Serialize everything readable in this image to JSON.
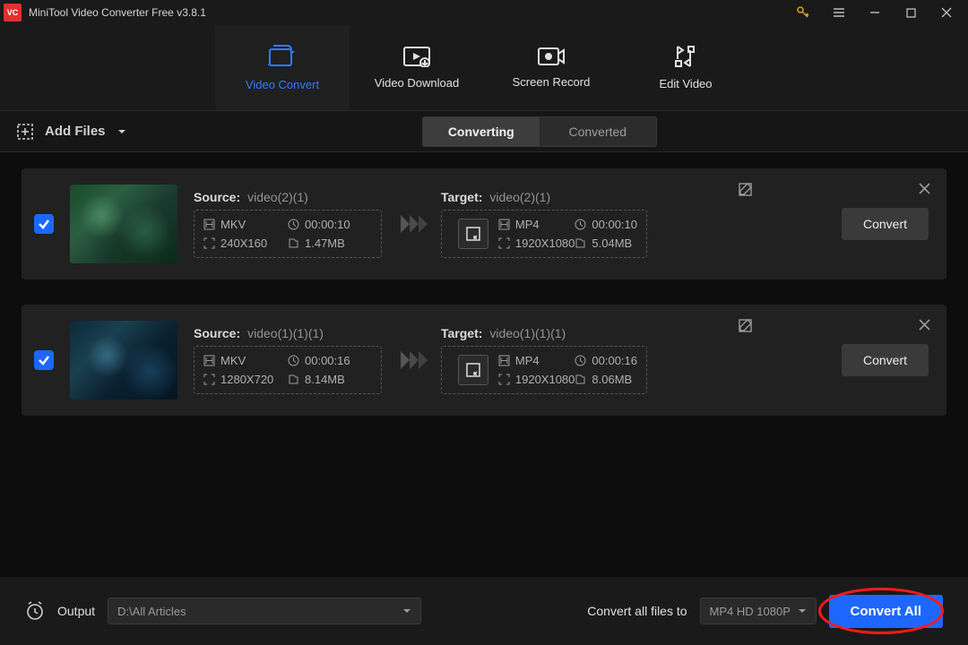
{
  "window": {
    "title": "MiniTool Video Converter Free v3.8.1"
  },
  "tabs": {
    "convert": "Video Convert",
    "download": "Video Download",
    "record": "Screen Record",
    "edit": "Edit Video"
  },
  "toolbar": {
    "add_files": "Add Files",
    "seg_converting": "Converting",
    "seg_converted": "Converted"
  },
  "labels": {
    "source": "Source:",
    "target": "Target:",
    "convert": "Convert"
  },
  "tasks": [
    {
      "source_name": "video(2)(1)",
      "src": {
        "format": "MKV",
        "duration": "00:00:10",
        "resolution": "240X160",
        "size": "1.47MB"
      },
      "target_name": "video(2)(1)",
      "tgt": {
        "format": "MP4",
        "duration": "00:00:10",
        "resolution": "1920X1080",
        "size": "5.04MB"
      }
    },
    {
      "source_name": "video(1)(1)(1)",
      "src": {
        "format": "MKV",
        "duration": "00:00:16",
        "resolution": "1280X720",
        "size": "8.14MB"
      },
      "target_name": "video(1)(1)(1)",
      "tgt": {
        "format": "MP4",
        "duration": "00:00:16",
        "resolution": "1920X1080",
        "size": "8.06MB"
      }
    }
  ],
  "bottom": {
    "output_label": "Output",
    "output_path": "D:\\All Articles",
    "allto_label": "Convert all files to",
    "allto_value": "MP4 HD 1080P",
    "convert_all": "Convert All"
  }
}
